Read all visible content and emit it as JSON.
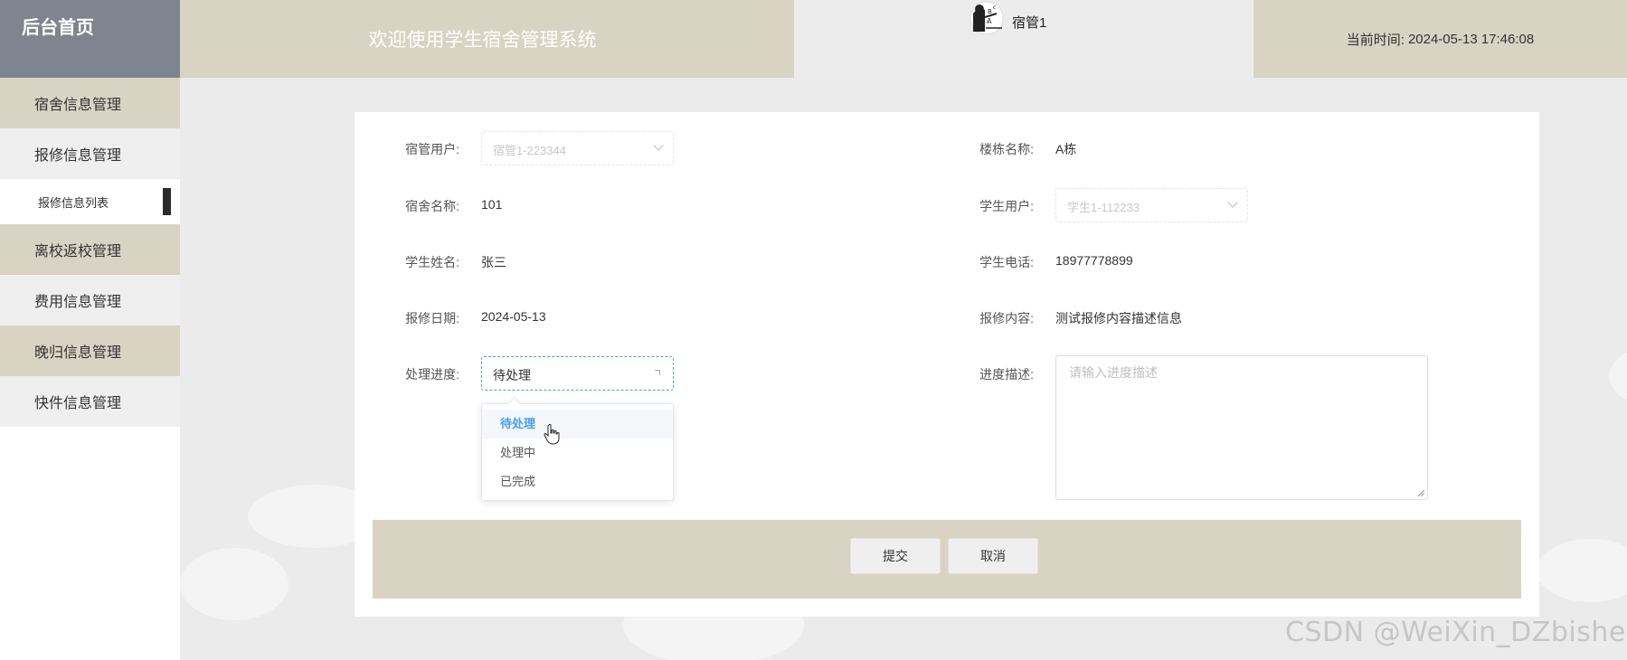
{
  "header": {
    "brand": "后台首页",
    "welcome": "欢迎使用学生宿舍管理系统",
    "user_name": "宿管1",
    "time_label": "当前时间:",
    "time_value": "2024-05-13 17:46:08"
  },
  "sidebar": {
    "items": [
      {
        "label": "宿舍信息管理"
      },
      {
        "label": "报修信息管理"
      },
      {
        "label": "离校返校管理"
      },
      {
        "label": "费用信息管理"
      },
      {
        "label": "晚归信息管理"
      },
      {
        "label": "快件信息管理"
      }
    ],
    "sub_active": "报修信息列表"
  },
  "form": {
    "dorm_manager": {
      "label": "宿管用户:",
      "value": "宿管1-223344"
    },
    "building": {
      "label": "楼栋名称:",
      "value": "A栋"
    },
    "dorm_name": {
      "label": "宿舍名称:",
      "value": "101"
    },
    "student_user": {
      "label": "学生用户:",
      "value": "学生1-112233"
    },
    "student_name": {
      "label": "学生姓名:",
      "value": "张三"
    },
    "student_phone": {
      "label": "学生电话:",
      "value": "18977778899"
    },
    "repair_date": {
      "label": "报修日期:",
      "value": "2024-05-13"
    },
    "repair_content": {
      "label": "报修内容:",
      "value": "测试报修内容描述信息"
    },
    "progress": {
      "label": "处理进度:",
      "value": "待处理",
      "options": [
        "待处理",
        "处理中",
        "已完成"
      ]
    },
    "progress_desc": {
      "label": "进度描述:",
      "placeholder": "请输入进度描述"
    }
  },
  "actions": {
    "submit": "提交",
    "cancel": "取消"
  },
  "watermark": "CSDN @WeiXin_DZbishe",
  "colors": {
    "tan": "#d9d3c3",
    "slate": "#7f858e",
    "accent": "#409eff"
  }
}
